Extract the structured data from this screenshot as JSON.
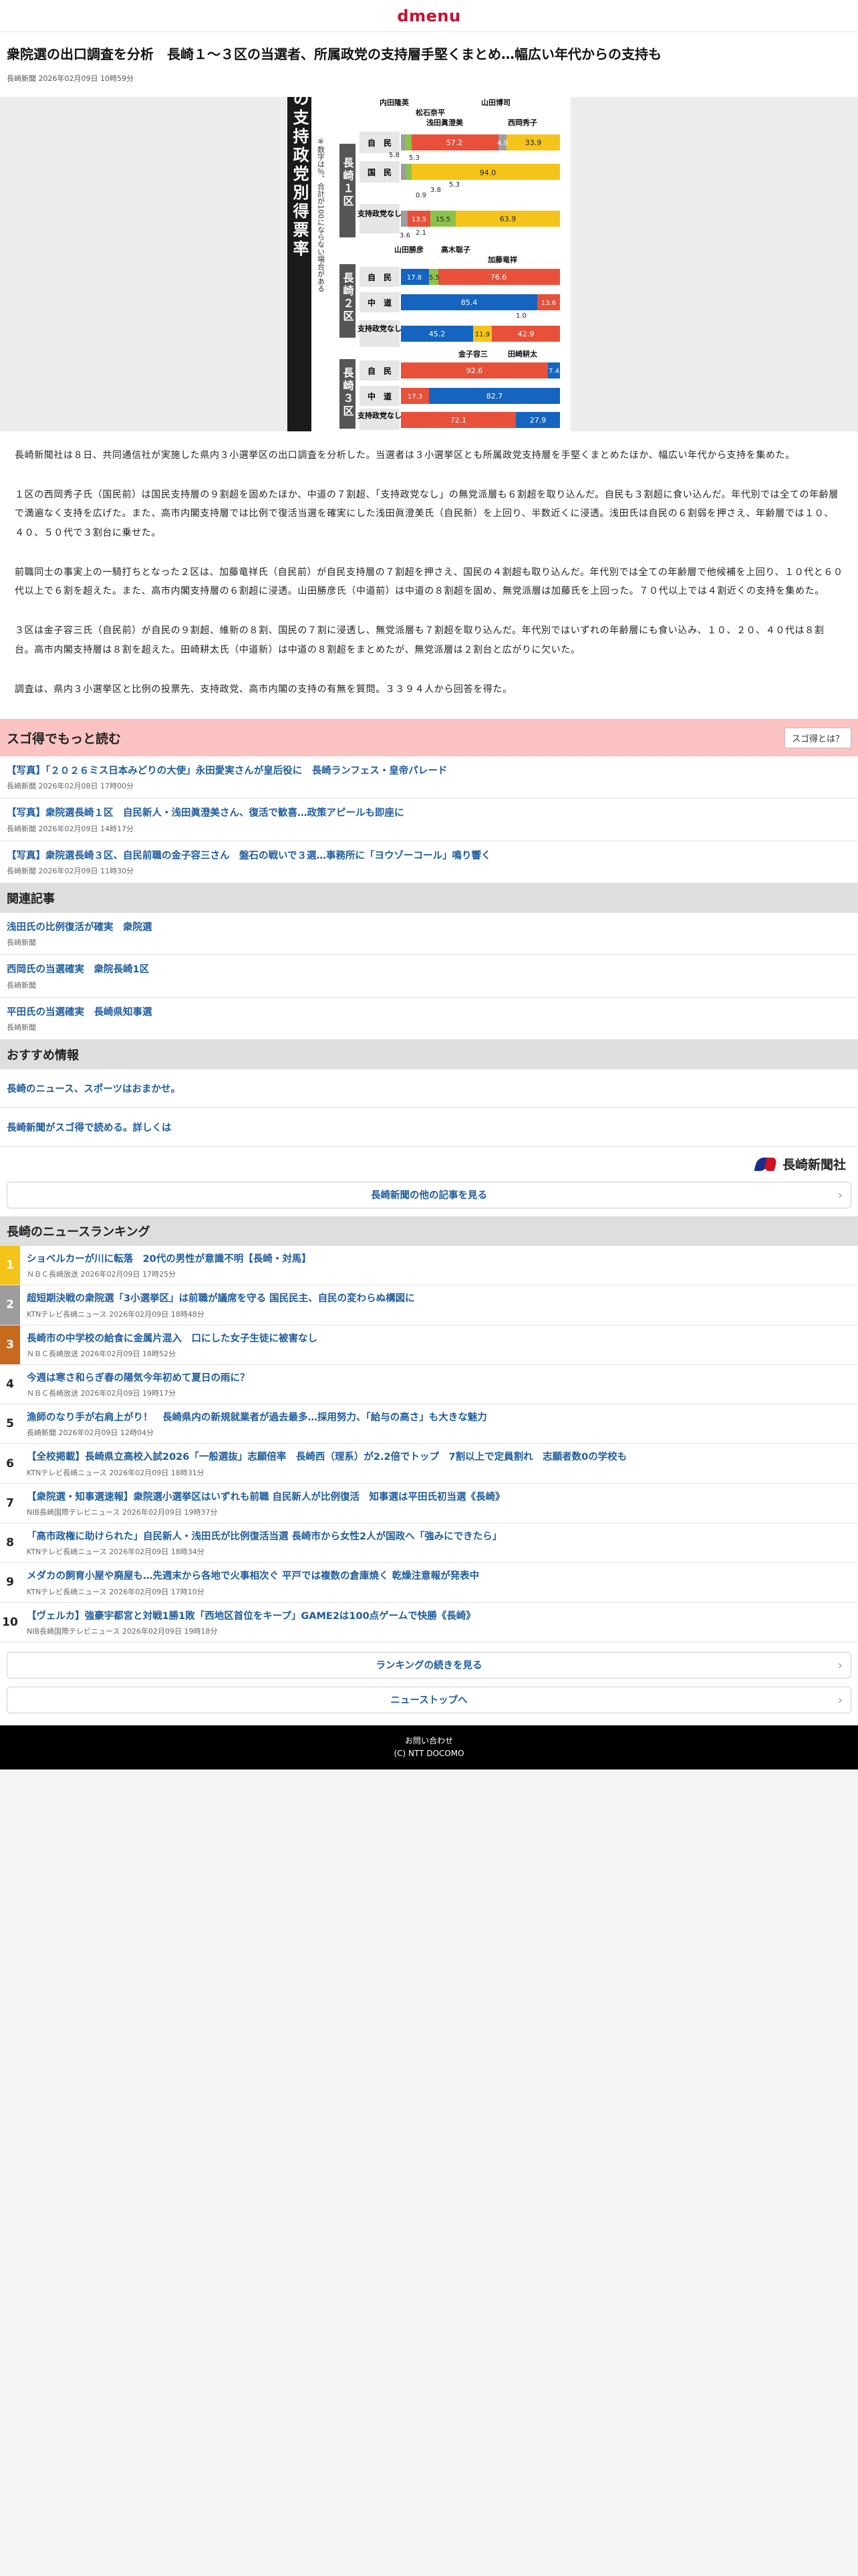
{
  "header": {
    "logo": "dmenu"
  },
  "article": {
    "title": "衆院選の出口調査を分析　長崎１～３区の当選者、所属政党の支持層手堅くまとめ…幅広い年代からの支持も",
    "byline": "長崎新聞 2026年02月09日 10時59分",
    "paragraphs": [
      "長崎新聞社は８日、共同通信社が実施した県内３小選挙区の出口調査を分析した。当選者は３小選挙区とも所属政党支持層を手堅くまとめたほか、幅広い年代から支持を集めた。",
      "１区の西岡秀子氏（国民前）は国民支持層の９割超を固めたほか、中道の７割超、「支持政党なし」の無党派層も６割超を取り込んだ。自民も３割超に食い込んだ。年代別では全ての年齢層で満遍なく支持を広げた。また、高市内閣支持層では比例で復活当選を確実にした浅田眞澄美氏（自民新）を上回り、半数近くに浸透。浅田氏は自民の６割弱を押さえ、年齢層では１０、４０、５０代で３割台に乗せた。",
      "前職同士の事実上の一騎打ちとなった２区は、加藤竜祥氏（自民前）が自民支持層の７割超を押さえ、国民の４割超も取り込んだ。年代別では全ての年齢層で他候補を上回り、１０代と６０代以上で６割を超えた。また、高市内閣支持層の６割超に浸透。山田勝彦氏（中道前）は中道の８割超を固め、無党派層は加藤氏を上回った。７０代以上では４割近くの支持を集めた。",
      "３区は金子容三氏（自民前）が自民の９割超、維新の８割、国民の７割に浸透し、無党派層も７割超を取り込んだ。年代別ではいずれの年齢層にも食い込み、１０、２０、４０代は８割台。高市内閣支持層は８割を超えた。田崎耕太氏（中道新）は中道の８割超をまとめたが、無党派層は２割台と広がりに欠いた。",
      "調査は、県内３小選挙区と比例の投票先、支持政党、高市内閣の支持の有無を質問。３３９４人から回答を得た。"
    ]
  },
  "figure": {
    "vertical_title": "各候補者の支持政党別得票率",
    "note": "※数字は％、合計が100にならない場合がある",
    "districts": [
      "長崎１区",
      "長崎２区",
      "長崎３区"
    ],
    "d1_candidates": [
      "内田隆英",
      "松石奈平",
      "浅田眞澄美",
      "山田博司",
      "西岡秀子"
    ],
    "d1_parties": [
      "自　民",
      "国　民",
      "支持政党なし"
    ],
    "d1_labels": [
      [
        "57.2",
        "4.9",
        "33.9"
      ],
      [
        "5.8",
        "5.3",
        "94.0"
      ],
      [
        "0.9",
        "3.8",
        "5.3"
      ],
      [
        "13.5",
        "15.5",
        "63.9"
      ],
      [
        "3.6",
        "2.1"
      ]
    ],
    "d2_candidates": [
      "山田勝彦",
      "高木聡子",
      "加藤竜祥"
    ],
    "d2_parties": [
      "自　民",
      "中　道",
      "支持政党なし"
    ],
    "d2_labels": [
      [
        "17.8",
        "5.5",
        "76.6"
      ],
      [
        "85.4",
        "13.6"
      ],
      [
        "1.0"
      ],
      [
        "45.2",
        "11.9",
        "42.9"
      ]
    ],
    "d3_candidates": [
      "金子容三",
      "田崎耕太"
    ],
    "d3_parties": [
      "自　民",
      "中　道",
      "支持政党なし"
    ],
    "d3_labels": [
      [
        "92.6",
        "7.4"
      ],
      [
        "17.3",
        "82.7"
      ],
      [
        "72.1",
        "27.9"
      ]
    ]
  },
  "sugo": {
    "title": "スゴ得でもっと読む",
    "about_button": "スゴ得とは？",
    "items": [
      {
        "title": "【写真】「２０２６ミス日本みどりの大使」永田愛実さんが皇后役に　長崎ランフェス・皇帝パレード",
        "meta": "長崎新聞 2026年02月08日 17時00分"
      },
      {
        "title": "【写真】衆院選長崎１区　自民新人・浅田眞澄美さん、復活で歓喜…政策アピールも即座に",
        "meta": "長崎新聞 2026年02月09日 14時17分"
      },
      {
        "title": "【写真】衆院選長崎３区、自民前職の金子容三さん　盤石の戦いで３選…事務所に「ヨウゾーコール」鳴り響く",
        "meta": "長崎新聞 2026年02月09日 11時30分"
      }
    ]
  },
  "related": {
    "title": "関連記事",
    "items": [
      {
        "title": "浅田氏の比例復活が確実　衆院選",
        "meta": "長崎新聞"
      },
      {
        "title": "西岡氏の当選確実　衆院長崎1区",
        "meta": "長崎新聞"
      },
      {
        "title": "平田氏の当選確実　長崎県知事選",
        "meta": "長崎新聞"
      }
    ]
  },
  "recommend": {
    "title": "おすすめ情報",
    "items": [
      "長崎のニュース、スポーツはおまかせ。",
      "長崎新聞がスゴ得で読める。詳しくは"
    ]
  },
  "publisher": {
    "name": "長崎新聞社",
    "more_button": "長崎新聞の他の記事を見る"
  },
  "ranking": {
    "title": "長崎のニュースランキング",
    "items": [
      {
        "rank": "1",
        "title": "ショベルカーが川に転落　20代の男性が意識不明【長崎・対馬】",
        "meta": "ＮＢＣ長崎放送 2026年02月09日 17時25分"
      },
      {
        "rank": "2",
        "title": "超短期決戦の衆院選「3小選挙区」は前職が議席を守る 国民民主、自民の変わらぬ構図に",
        "meta": "KTNテレビ長崎ニュース 2026年02月09日 18時48分"
      },
      {
        "rank": "3",
        "title": "長崎市の中学校の給食に金属片混入　口にした女子生徒に被害なし",
        "meta": "ＮＢＣ長崎放送 2026年02月09日 18時52分"
      },
      {
        "rank": "4",
        "title": "今週は寒さ和らぎ春の陽気今年初めて夏日の雨に？",
        "meta": "ＮＢＣ長崎放送 2026年02月09日 19時17分"
      },
      {
        "rank": "5",
        "title": "漁師のなり手が右肩上がり！　長崎県内の新規就業者が過去最多…採用努力、「給与の高さ」も大きな魅力",
        "meta": "長崎新聞 2026年02月09日 12時04分"
      },
      {
        "rank": "6",
        "title": "【全校掲載】長崎県立高校入試2026「一般選抜」志願倍率　長崎西（理系）が2.2倍でトップ　7割以上で定員割れ　志願者数0の学校も",
        "meta": "KTNテレビ長崎ニュース 2026年02月09日 18時31分"
      },
      {
        "rank": "7",
        "title": "【衆院選・知事選速報】衆院選小選挙区はいずれも前職 自民新人が比例復活　知事選は平田氏初当選《長崎》",
        "meta": "NIB長崎国際テレビニュース 2026年02月09日 19時37分"
      },
      {
        "rank": "8",
        "title": "「高市政権に助けられた」自民新人・浅田氏が比例復活当選 長崎市から女性2人が国政へ「強みにできたら」",
        "meta": "KTNテレビ長崎ニュース 2026年02月09日 18時34分"
      },
      {
        "rank": "9",
        "title": "メダカの飼育小屋や廃屋も…先週末から各地で火事相次ぐ 平戸では複数の倉庫焼く 乾燥注意報が発表中",
        "meta": "KTNテレビ長崎ニュース 2026年02月09日 17時10分"
      },
      {
        "rank": "10",
        "title": "【ヴェルカ】強豪宇都宮と対戦1勝1敗「西地区首位をキープ」GAME2は100点ゲームで快勝《長崎》",
        "meta": "NIB長崎国際テレビニュース 2026年02月09日 19時18分"
      }
    ],
    "more_button": "ランキングの続きを見る",
    "top_button": "ニューストップへ"
  },
  "footer": {
    "contact": "お問い合わせ",
    "copyright": "(C) NTT DOCOMO"
  },
  "colors": {
    "accent": "#c8102e",
    "link": "#1e5c9e",
    "sugo_bg": "#fcc3c3",
    "ldp_red": "#e8503a",
    "dpfp_yellow": "#f5c41a",
    "cdp_blue": "#1565c0",
    "green": "#8bc34a"
  }
}
